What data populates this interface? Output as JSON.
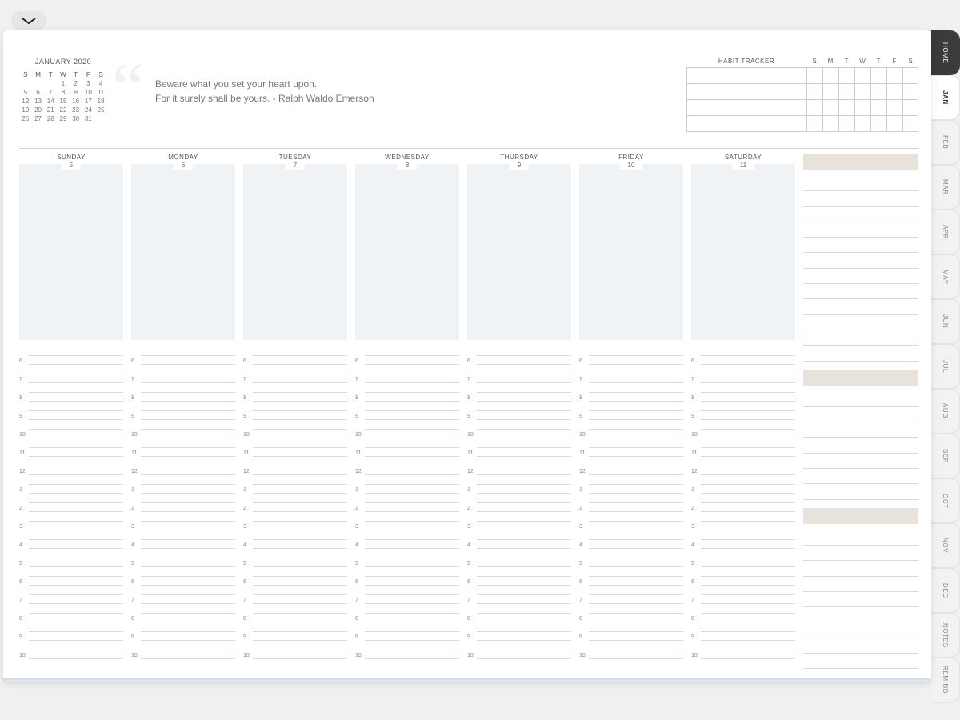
{
  "side_tabs": [
    {
      "label": "HOME",
      "kind": "home"
    },
    {
      "label": "JAN",
      "kind": "active"
    },
    {
      "label": "FEB",
      "kind": ""
    },
    {
      "label": "MAR",
      "kind": ""
    },
    {
      "label": "APR",
      "kind": ""
    },
    {
      "label": "MAY",
      "kind": ""
    },
    {
      "label": "JUN",
      "kind": ""
    },
    {
      "label": "JUL",
      "kind": ""
    },
    {
      "label": "AUG",
      "kind": ""
    },
    {
      "label": "SEP",
      "kind": ""
    },
    {
      "label": "OCT",
      "kind": ""
    },
    {
      "label": "NOV",
      "kind": ""
    },
    {
      "label": "DEC",
      "kind": ""
    },
    {
      "label": "NOTES",
      "kind": ""
    },
    {
      "label": "REMIND",
      "kind": ""
    }
  ],
  "mini_calendar": {
    "title": "JANUARY 2020",
    "dow": [
      "S",
      "M",
      "T",
      "W",
      "T",
      "F",
      "S"
    ],
    "weeks": [
      [
        "",
        "",
        "",
        "1",
        "2",
        "3",
        "4"
      ],
      [
        "5",
        "6",
        "7",
        "8",
        "9",
        "10",
        "11"
      ],
      [
        "12",
        "13",
        "14",
        "15",
        "16",
        "17",
        "18"
      ],
      [
        "19",
        "20",
        "21",
        "22",
        "23",
        "24",
        "25"
      ],
      [
        "26",
        "27",
        "28",
        "29",
        "30",
        "31",
        ""
      ]
    ]
  },
  "quote": {
    "line1": "Beware what you set your heart upon.",
    "line2": "For it surely shall be yours. - Ralph Waldo Emerson"
  },
  "habit": {
    "title": "HABIT TRACKER",
    "dow": [
      "S",
      "M",
      "T",
      "W",
      "T",
      "F",
      "S"
    ],
    "rows": 4
  },
  "week": {
    "days": [
      {
        "name": "SUNDAY",
        "num": "5"
      },
      {
        "name": "MONDAY",
        "num": "6"
      },
      {
        "name": "TUESDAY",
        "num": "7"
      },
      {
        "name": "WEDNESDAY",
        "num": "8"
      },
      {
        "name": "THURSDAY",
        "num": "9"
      },
      {
        "name": "FRIDAY",
        "num": "10"
      },
      {
        "name": "SATURDAY",
        "num": "11"
      }
    ],
    "hours": [
      "6",
      "7",
      "8",
      "9",
      "10",
      "11",
      "12",
      "1",
      "2",
      "3",
      "4",
      "5",
      "6",
      "7",
      "8",
      "9",
      "10"
    ]
  },
  "side_sections": {
    "count": 3,
    "lines_per": [
      12,
      7,
      9
    ]
  }
}
